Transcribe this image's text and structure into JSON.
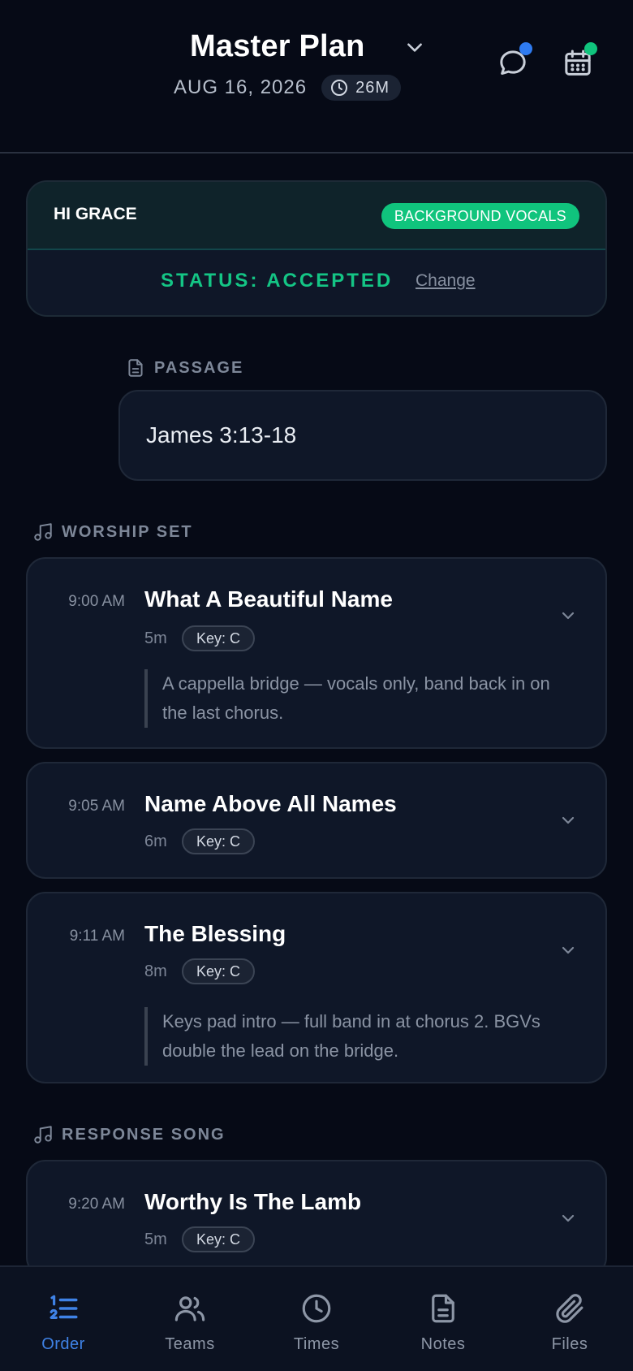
{
  "header": {
    "title": "Master Plan",
    "date": "AUG 16, 2026",
    "duration": "26M",
    "messages_dot_color": "#2f7bf0",
    "calendar_dot_color": "#10c47d"
  },
  "status_card": {
    "greeting": "HI GRACE",
    "role": "BACKGROUND VOCALS",
    "status": "STATUS: ACCEPTED",
    "change_label": "Change"
  },
  "passage": {
    "label": "PASSAGE",
    "text": "James 3:13-18"
  },
  "sections": [
    {
      "label": "WORSHIP SET",
      "songs": [
        {
          "time": "9:00 AM",
          "title": "What A Beautiful Name",
          "duration": "5m",
          "key": "Key: C",
          "note": "A cappella bridge — vocals only, band back in on the last chorus."
        },
        {
          "time": "9:05 AM",
          "title": "Name Above All Names",
          "duration": "6m",
          "key": "Key: C",
          "note": ""
        },
        {
          "time": "9:11 AM",
          "title": "The Blessing",
          "duration": "8m",
          "key": "Key: C",
          "note": "Keys pad intro — full band in at chorus 2. BGVs double the lead on the bridge."
        }
      ]
    },
    {
      "label": "RESPONSE SONG",
      "songs": [
        {
          "time": "9:20 AM",
          "title": "Worthy Is The Lamb",
          "duration": "5m",
          "key": "Key: C",
          "note": ""
        }
      ]
    }
  ],
  "nav": {
    "active": "Order",
    "items": [
      {
        "label": "Order",
        "icon": "list-ordered-icon"
      },
      {
        "label": "Teams",
        "icon": "users-icon"
      },
      {
        "label": "Times",
        "icon": "clock-icon"
      },
      {
        "label": "Notes",
        "icon": "document-icon"
      },
      {
        "label": "Files",
        "icon": "paperclip-icon"
      }
    ]
  },
  "colors": {
    "background": "#060a16",
    "card": "#0f1728",
    "accent_green": "#10c47d",
    "accent_blue": "#3f82e6"
  }
}
